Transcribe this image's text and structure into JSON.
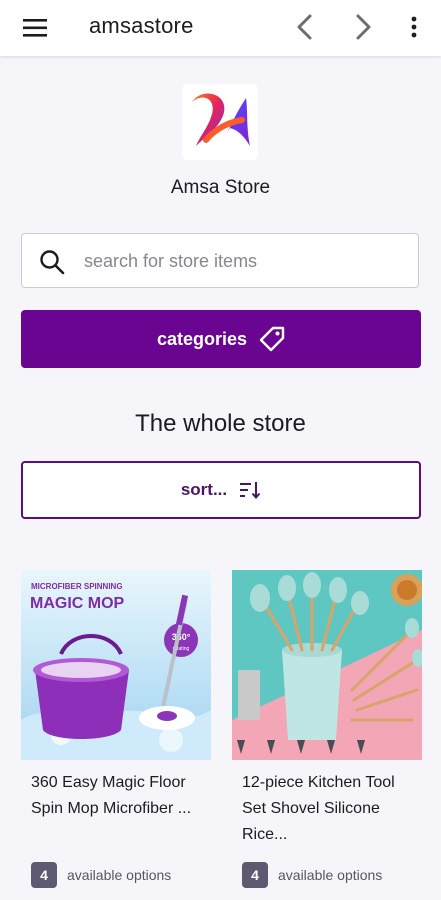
{
  "app_bar": {
    "title": "amsastore",
    "icons": [
      "menu-icon",
      "back-icon",
      "forward-icon",
      "more-vert-icon"
    ]
  },
  "store": {
    "name": "Amsa Store",
    "logo_icon": "store-logo-icon"
  },
  "search": {
    "placeholder": "search for store items",
    "value": ""
  },
  "categories_button": {
    "label": "categories",
    "icon": "tag-icon"
  },
  "section": {
    "title": "The whole store"
  },
  "sort_button": {
    "label": "sort...",
    "icon": "sort-icon"
  },
  "products": [
    {
      "image_caption": "MICROFIBER SPINNING",
      "image_title": "MAGIC MOP",
      "image_badge": "360°",
      "image_badge_sub": "rotating",
      "name": "360 Easy Magic Floor Spin Mop Microfiber ...",
      "option_count": "4",
      "options_label": "available options"
    },
    {
      "name": "12-piece Kitchen Tool Set Shovel Silicone Rice...",
      "option_count": "4",
      "options_label": "available options"
    }
  ],
  "colors": {
    "primary": "#6a0592",
    "sort_border": "#5b0d7c",
    "badge": "#5e5870",
    "background": "#f6f5fa"
  }
}
